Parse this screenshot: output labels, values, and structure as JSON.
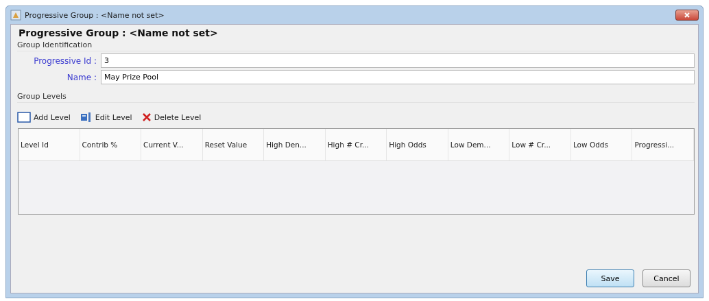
{
  "window": {
    "title": "Progressive Group : <Name not set>"
  },
  "heading": "Progressive Group : <Name not set>",
  "identification": {
    "title": "Group Identification",
    "fields": [
      {
        "label": "Progressive Id :",
        "value": "3"
      },
      {
        "label": "Name :",
        "value": "May Prize Pool"
      }
    ]
  },
  "levels": {
    "title": "Group Levels",
    "toolbar": [
      {
        "kind": "add",
        "label": "Add Level"
      },
      {
        "kind": "edit",
        "label": "Edit Level"
      },
      {
        "kind": "delete",
        "label": "Delete Level"
      }
    ],
    "table": {
      "columns": [
        "Level Id",
        "Contrib %",
        "Current V...",
        "Reset Value",
        "High Den...",
        "High # Cr...",
        "High Odds",
        "Low Dem...",
        "Low # Cr...",
        "Low Odds",
        "Progressi..."
      ]
    }
  },
  "buttons": [
    {
      "label": "Save",
      "default": true
    },
    {
      "label": "Cancel",
      "default": false
    }
  ]
}
